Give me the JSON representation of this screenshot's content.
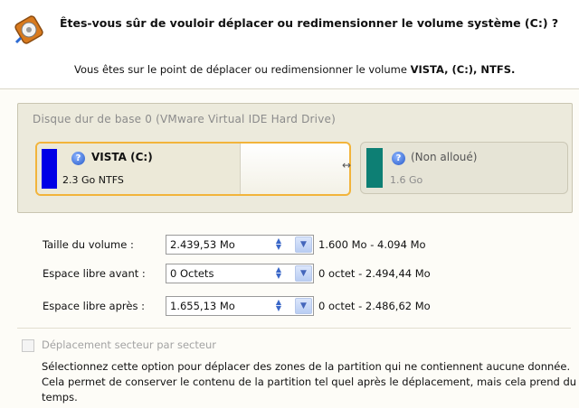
{
  "header": {
    "title": "Êtes-vous sûr de vouloir déplacer ou redimensionner le volume système (C:) ?",
    "subtitle_prefix": "Vous êtes sur le point de déplacer ou redimensionner le volume",
    "subtitle_volume": "VISTA, (C:), NTFS.",
    "icon": "disk-resize-icon"
  },
  "disk": {
    "title": "Disque dur de base 0 (VMware Virtual IDE Hard Drive)",
    "partitions": [
      {
        "name": "VISTA (C:)",
        "info": "2.3 Go NTFS",
        "color": "#0000e6",
        "used_fraction": 0.65
      },
      {
        "name": "(Non alloué)",
        "info": "1.6 Go",
        "color": "#0d7f74"
      }
    ]
  },
  "fields": [
    {
      "label": "Taille du volume :",
      "value": "2.439,53 Mo",
      "range": "1.600 Mo - 4.094 Mo"
    },
    {
      "label": "Espace libre avant :",
      "value": "0 Octets",
      "range": "0 octet - 2.494,44 Mo"
    },
    {
      "label": "Espace libre après :",
      "value": "1.655,13 Mo",
      "range": "0 octet - 2.486,62 Mo"
    }
  ],
  "option": {
    "label": "Déplacement secteur par secteur",
    "checked": false,
    "description": "Sélectionnez cette option pour déplacer des zones de la partition qui ne contiennent aucune donnée. Cela permet de conserver le contenu de la partition tel quel après le déplacement, mais cela prend du temps."
  },
  "colors": {
    "selected_border": "#f2b43b"
  }
}
